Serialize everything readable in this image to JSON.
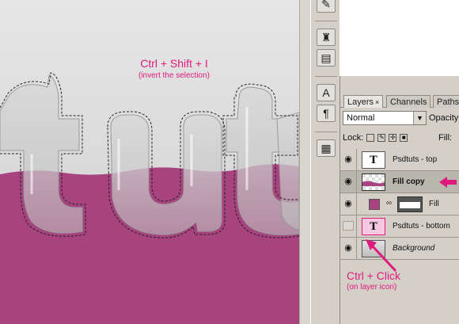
{
  "canvas": {
    "tip_main": "Ctrl + Shift + I",
    "tip_sub": "(invert the selection)",
    "text_art": "tut",
    "colors": {
      "background": "#d8d8d8",
      "fill": "#a7437e",
      "selection": "#222222"
    }
  },
  "toolbar": {
    "icons": [
      "brush-tool-icon",
      "clone-stamp-icon",
      "history-brush-icon",
      "type-tool-icon",
      "note-tool-icon",
      "info-panel-icon"
    ]
  },
  "layers_panel": {
    "tabs": [
      {
        "label": "Layers",
        "close": "×"
      },
      {
        "label": "Channels"
      },
      {
        "label": "Paths"
      }
    ],
    "blend_mode": "Normal",
    "opacity_label": "Opacity:",
    "lock_label": "Lock:",
    "fill_label": "Fill:",
    "layers": [
      {
        "name": "Psdtuts - top",
        "thumb": "T",
        "visible": true
      },
      {
        "name": "Fill copy",
        "visible": true,
        "selected": true
      },
      {
        "name": "Fill",
        "visible": true
      },
      {
        "name": "Psdtuts - bottom",
        "thumb": "T",
        "visible": false
      },
      {
        "name": "Background",
        "visible": true
      }
    ]
  },
  "callout": {
    "main": "Ctrl + Click",
    "sub": "(on layer icon)",
    "accent": "#e0197d"
  }
}
